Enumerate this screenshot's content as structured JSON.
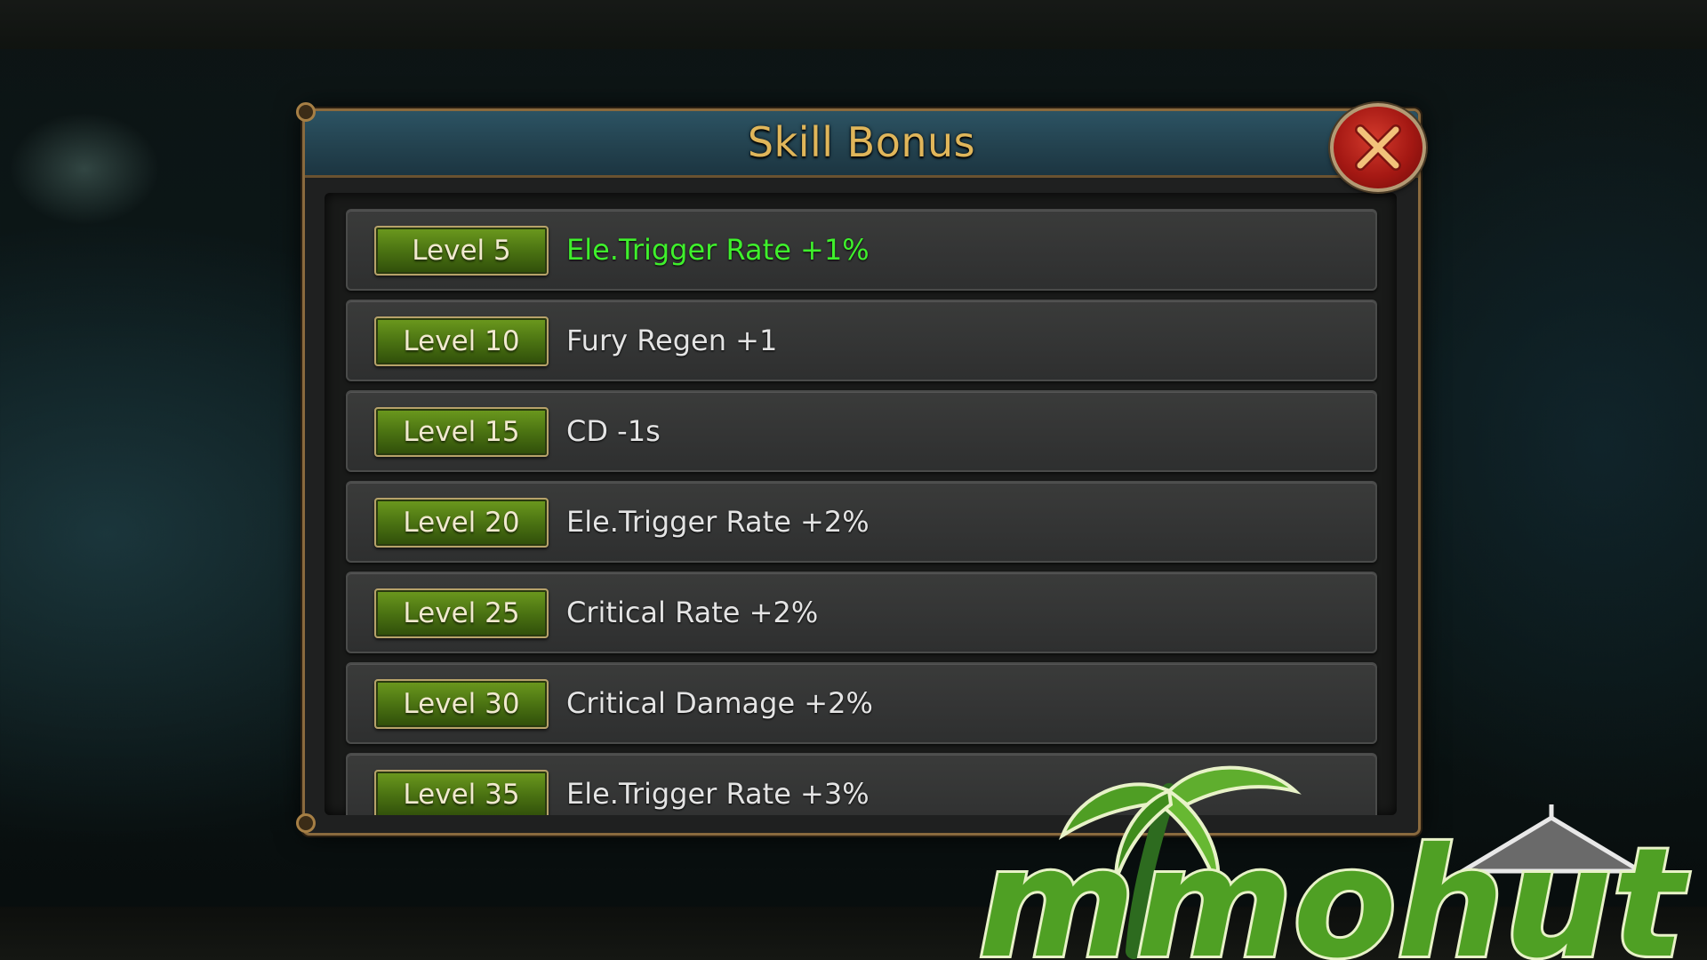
{
  "dialog": {
    "title": "Skill Bonus",
    "close_icon": "close-x-icon"
  },
  "bonuses": [
    {
      "level": "Level 5",
      "text": "Ele.Trigger Rate +1%",
      "active": true
    },
    {
      "level": "Level 10",
      "text": "Fury Regen +1",
      "active": false
    },
    {
      "level": "Level 15",
      "text": "CD -1s",
      "active": false
    },
    {
      "level": "Level 20",
      "text": "Ele.Trigger Rate +2%",
      "active": false
    },
    {
      "level": "Level 25",
      "text": "Critical Rate +2%",
      "active": false
    },
    {
      "level": "Level 30",
      "text": "Critical Damage +2%",
      "active": false
    },
    {
      "level": "Level 35",
      "text": "Ele.Trigger Rate +3%",
      "active": false
    }
  ],
  "watermark": {
    "text": "mmohut",
    "icon": "palm-tree-hut-logo"
  },
  "colors": {
    "title": "#e0b65a",
    "active_bonus": "#3ff02c",
    "inactive_bonus": "#e4e4e4",
    "badge_green": "#4b7312",
    "close_red": "#a41813"
  }
}
